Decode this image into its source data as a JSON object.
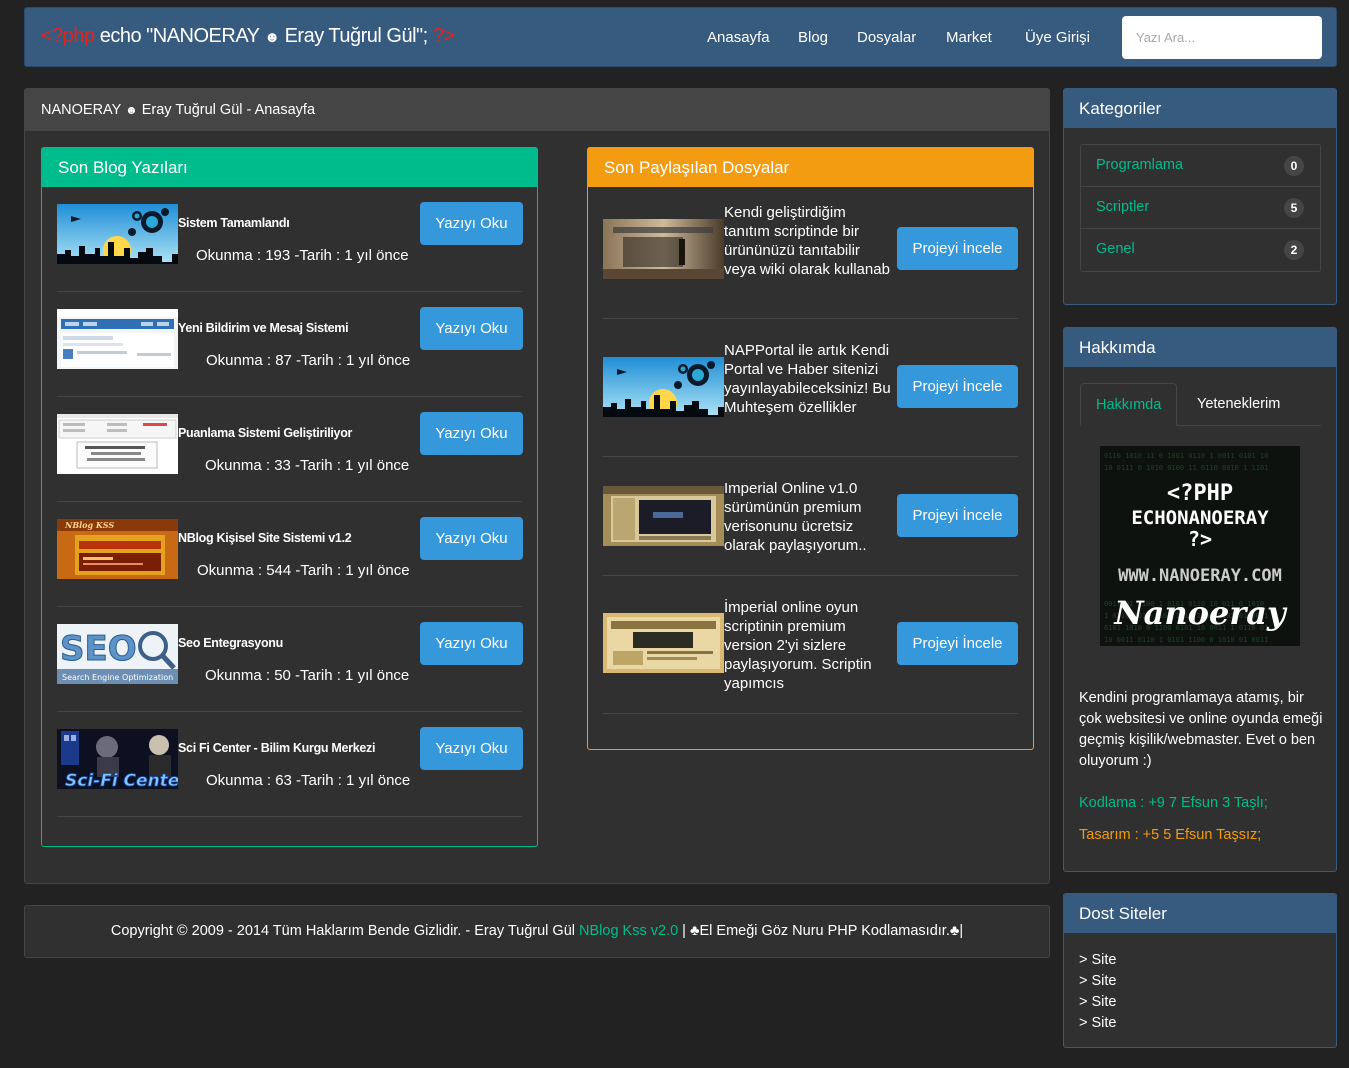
{
  "navbar": {
    "brand_open": "<?php",
    "brand_echo": " echo \"NANOERAY ",
    "brand_smile": "☻",
    "brand_name": " Eray Tuğrul Gül\"; ",
    "brand_close": "?>",
    "links": [
      "Anasayfa",
      "Blog",
      "Dosyalar",
      "Market",
      "Üye Girişi"
    ],
    "search_placeholder": "Yazı Ara..."
  },
  "main": {
    "heading_name": "NANOERAY ",
    "heading_smile": "☻",
    "heading_rest": " Eray Tuğrul Gül - Anasayfa",
    "blog_title": "Son Blog Yazıları",
    "files_title": "Son Paylaşılan Dosyalar",
    "blog_button_label": "Yazıyı Oku",
    "file_button_label": "Projeyi İncele"
  },
  "blog_posts": [
    {
      "title": "Sistem Tamamlandı",
      "meta": "Okunma : 193 -Tarih : 1 yıl önce"
    },
    {
      "title": "Yeni Bildirim ve Mesaj Sistemi",
      "meta": "Okunma : 87 -Tarih : 1 yıl önce"
    },
    {
      "title": "Puanlama Sistemi Geliştiriliyor",
      "meta": "Okunma : 33 -Tarih : 1 yıl önce"
    },
    {
      "title": "NBlog Kişisel Site Sistemi v1.2",
      "meta": "Okunma : 544 -Tarih : 1 yıl önce"
    },
    {
      "title": "Seo Entegrasyonu",
      "meta": "Okunma : 50 -Tarih : 1 yıl önce"
    },
    {
      "title": "Sci Fi Center - Bilim Kurgu Merkezi",
      "meta": "Okunma : 63 -Tarih : 1 yıl önce"
    }
  ],
  "files": [
    {
      "desc": "Kendi geliştirdiğim tanıtım scriptinde bir ürününüzü tanıtabilir veya wiki olarak kullanab"
    },
    {
      "desc": "NAPPortal ile artık Kendi Portal ve Haber sitenizi yayınlayabileceksiniz! Bu Muhteşem özellikler"
    },
    {
      "desc": "Imperial Online v1.0 sürümünün premium verisonunu ücretsiz olarak paylaşıyorum.."
    },
    {
      "desc": "İmperial online oyun scriptinin premium version 2'yi sizlere paylaşıyorum. Scriptin yapımcıs"
    }
  ],
  "thumb_texts": {
    "seo": "SEO",
    "seo_sub": "Search Engine Optimization",
    "nblog": "NBlog KSS",
    "scifi": "Sci-Fi Center"
  },
  "sidebar": {
    "categories_title": "Kategoriler",
    "categories": [
      {
        "label": "Programlama",
        "count": "0"
      },
      {
        "label": "Scriptler",
        "count": "5"
      },
      {
        "label": "Genel",
        "count": "2"
      }
    ],
    "about_title": "Hakkımda",
    "tabs": [
      "Hakkımda",
      "Yeteneklerim"
    ],
    "about_image_lines": [
      "<?PHP",
      "ECHONANOERAY",
      "?>",
      "WWW.NANOERAY.COM",
      "Nanoeray"
    ],
    "about_text": "Kendini programlamaya atamış, bir çok websitesi ve online oyunda emeği geçmiş kişilik/webmaster. Evet o ben oluyorum :)",
    "skill_coding": "Kodlama : +9 7 Efsun 3 Taşlı;",
    "skill_design": "Tasarım : +5 5 Efsun Taşsız;",
    "friends_title": "Dost Siteler",
    "friends": [
      "> Site",
      "> Site",
      "> Site",
      "> Site"
    ]
  },
  "footer": {
    "text": "Copyright © 2009 - 2014 Tüm Haklarım Bende Gizlidir. - Eray Tuğrul Gül ",
    "link": "NBlog Kss v2.0",
    "suffix": " | ♣El Emeği Göz Nuru PHP Kodlamasıdır.♣|"
  },
  "colors": {
    "primary": "#375a7f",
    "success": "#00bc8c",
    "warning": "#f39c12",
    "info": "#3498db",
    "background": "#222222"
  }
}
